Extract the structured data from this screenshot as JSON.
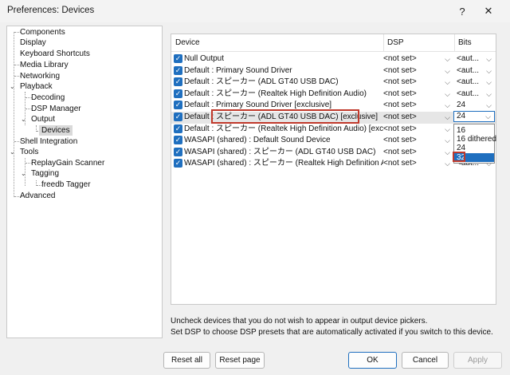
{
  "window": {
    "title": "Preferences: Devices",
    "help_glyph": "?",
    "close_glyph": "✕"
  },
  "tree": {
    "items": [
      {
        "label": "Components",
        "depth": 0
      },
      {
        "label": "Display",
        "depth": 0,
        "expander": true
      },
      {
        "label": "Keyboard Shortcuts",
        "depth": 0
      },
      {
        "label": "Media Library",
        "depth": 0,
        "expander": true
      },
      {
        "label": "Networking",
        "depth": 0
      },
      {
        "label": "Playback",
        "depth": 0,
        "expanded": true
      },
      {
        "label": "Decoding",
        "depth": 1
      },
      {
        "label": "DSP Manager",
        "depth": 1
      },
      {
        "label": "Output",
        "depth": 1,
        "expanded": true
      },
      {
        "label": "Devices",
        "depth": 2,
        "selected": true
      },
      {
        "label": "Shell Integration",
        "depth": 0
      },
      {
        "label": "Tools",
        "depth": 0,
        "expanded": true
      },
      {
        "label": "ReplayGain Scanner",
        "depth": 1
      },
      {
        "label": "Tagging",
        "depth": 1,
        "expanded": true
      },
      {
        "label": "freedb Tagger",
        "depth": 2
      },
      {
        "label": "Advanced",
        "depth": 0
      }
    ]
  },
  "grid": {
    "columns": {
      "device": "Device",
      "dsp": "DSP",
      "bits": "Bits"
    },
    "rows": [
      {
        "device": "Null Output",
        "dsp": "<not set>",
        "bits": "<aut..."
      },
      {
        "device": "Default : Primary Sound Driver",
        "dsp": "<not set>",
        "bits": "<aut..."
      },
      {
        "device": "Default : スピーカー (ADL GT40 USB DAC)",
        "dsp": "<not set>",
        "bits": "<aut..."
      },
      {
        "device": "Default : スピーカー (Realtek High Definition Audio)",
        "dsp": "<not set>",
        "bits": "<aut..."
      },
      {
        "device": "Default : Primary Sound Driver [exclusive]",
        "dsp": "<not set>",
        "bits": "24"
      },
      {
        "device": "Default : スピーカー (ADL GT40 USB DAC) [exclusive]",
        "dsp": "<not set>",
        "bits": "24",
        "selected": true
      },
      {
        "device": "Default : スピーカー (Realtek High Definition Audio) [exclusive]",
        "dsp": "<not set>",
        "bits": ""
      },
      {
        "device": "WASAPI (shared) : Default Sound Device",
        "dsp": "<not set>",
        "bits": ""
      },
      {
        "device": "WASAPI (shared) : スピーカー (ADL GT40 USB DAC)",
        "dsp": "<not set>",
        "bits": ""
      },
      {
        "device": "WASAPI (shared) : スピーカー (Realtek High Definition Audio)",
        "dsp": "<not set>",
        "bits": "<aut..."
      }
    ],
    "bits_dropdown": {
      "current": "24",
      "options": [
        "16",
        "16 dithered",
        "24",
        "32"
      ],
      "highlighted": "32"
    }
  },
  "hints": {
    "line1": "Uncheck devices that you do not wish to appear in output device pickers.",
    "line2": "Set DSP to choose DSP presets that are automatically activated if you switch to this device."
  },
  "buttons": {
    "reset_all": "Reset all",
    "reset_page": "Reset page",
    "ok": "OK",
    "cancel": "Cancel",
    "apply": "Apply"
  },
  "colors": {
    "accent": "#1f6fbf",
    "annotation": "#c0392b"
  }
}
